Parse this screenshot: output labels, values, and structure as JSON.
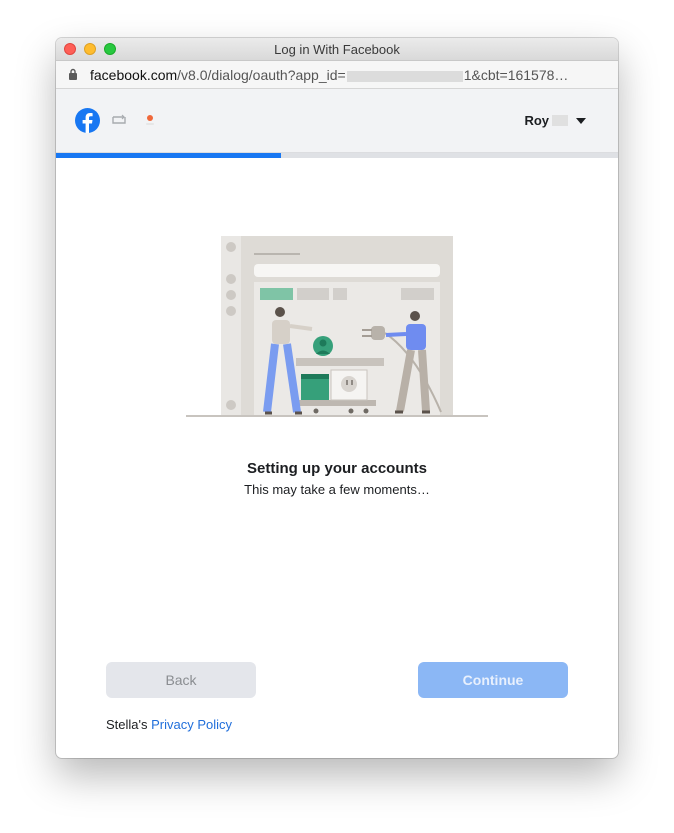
{
  "window": {
    "title": "Log in With Facebook"
  },
  "address_bar": {
    "host": "facebook.com",
    "path_start": "/v8.0/dialog/oauth?app_id=",
    "path_end": "1&cbt=161578…"
  },
  "header": {
    "user_name": "Roy"
  },
  "progress": {
    "fraction": 0.4
  },
  "content": {
    "heading": "Setting up your accounts",
    "subtext": "This may take a few moments…"
  },
  "buttons": {
    "back": "Back",
    "continue": "Continue"
  },
  "footer": {
    "owner": "Stella's",
    "privacy_link": "Privacy Policy"
  },
  "colors": {
    "facebook_blue": "#1877f2",
    "continue_disabled": "#8bb7f5",
    "link": "#216fdb"
  },
  "icons": [
    "close-icon",
    "minimize-icon",
    "zoom-icon",
    "lock-icon",
    "facebook-logo-icon",
    "link-icon",
    "app-icon",
    "chevron-down-icon"
  ]
}
